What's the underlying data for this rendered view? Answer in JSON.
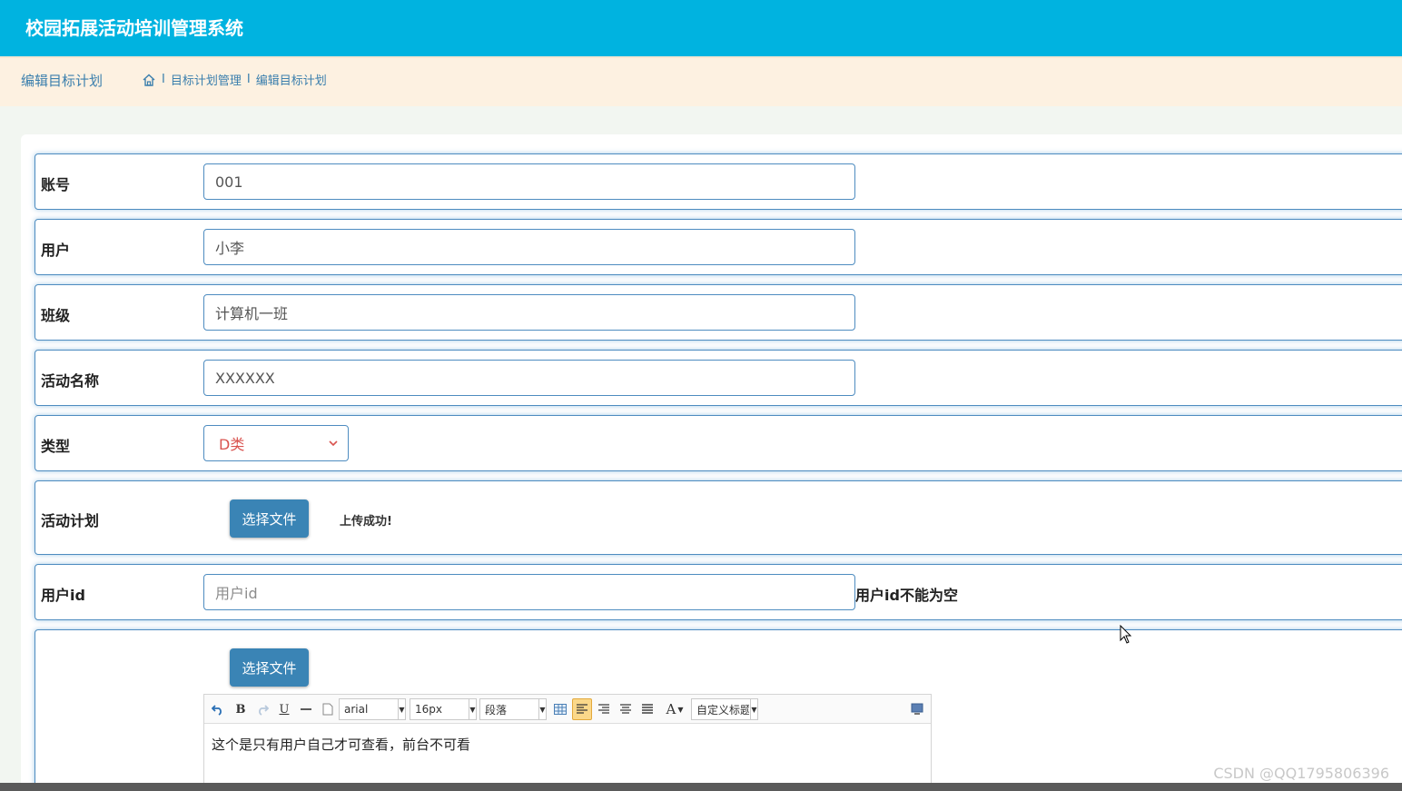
{
  "app": {
    "title": "校园拓展活动培训管理系统"
  },
  "breadcrumb": {
    "page_name": "编辑目标计划",
    "items": [
      "目标计划管理",
      "编辑目标计划"
    ],
    "separator": "I"
  },
  "form": {
    "account": {
      "label": "账号",
      "value": "001"
    },
    "user": {
      "label": "用户",
      "value": "小李"
    },
    "class": {
      "label": "班级",
      "value": "计算机一班"
    },
    "activity_name": {
      "label": "活动名称",
      "value": "XXXXXX"
    },
    "type": {
      "label": "类型",
      "value": "D类"
    },
    "activity_plan": {
      "label": "活动计划",
      "button": "选择文件",
      "status": "上传成功!"
    },
    "user_id": {
      "label": "用户id",
      "placeholder": "用户id",
      "error": "用户id不能为空"
    },
    "content": {
      "button": "选择文件",
      "toolbar": {
        "font": "arial",
        "size": "16px",
        "paragraph": "段落",
        "custom_title": "自定义标题",
        "bold": "B",
        "underline": "U",
        "font_color": "A"
      },
      "text": "这个是只有用户自己才可查看，前台不可看"
    }
  },
  "watermark": "CSDN @QQ1795806396",
  "colors": {
    "header": "#00b3e0",
    "accent": "#3a84b5",
    "crumb_bg": "#fdf1e1",
    "select_text": "#d9534f"
  }
}
